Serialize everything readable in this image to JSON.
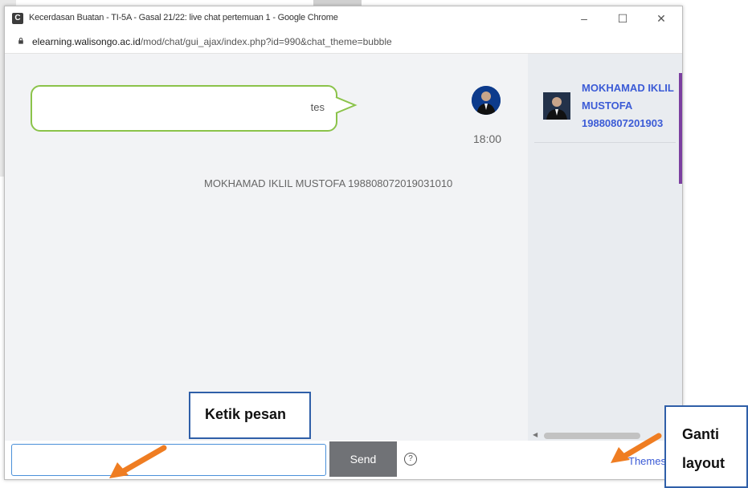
{
  "window": {
    "title": "Kecerdasan Buatan - TI-5A - Gasal 21/22: live chat pertemuan 1 - Google Chrome",
    "app_icon": "C",
    "minimize": "–",
    "maximize": "☐",
    "close": "✕"
  },
  "address": {
    "host": "elearning.walisongo.ac.id",
    "path": "/mod/chat/gui_ajax/index.php?id=990&chat_theme=bubble"
  },
  "chat": {
    "messages": [
      {
        "text": "tes",
        "time": "18:00",
        "sender": "MOKHAMAD IKLIL MUSTOFA 198808072019031010"
      }
    ]
  },
  "users": [
    {
      "name_line1": "MOKHAMAD IKLIL",
      "name_line2": "MUSTOFA",
      "name_line3": "19880807201903"
    }
  ],
  "composer": {
    "placeholder": "",
    "value": "",
    "send_label": "Send",
    "help_symbol": "?",
    "themes_label": "Themes"
  },
  "annotations": {
    "input_label": "Ketik pesan",
    "layout_label_1": "Ganti",
    "layout_label_2": "layout"
  },
  "colors": {
    "bubble_border": "#8bc34a",
    "link": "#3b5bd6",
    "send_button": "#707276",
    "arrow": "#ef7d22",
    "callout_border": "#2f5fa8"
  },
  "icons": {
    "lock": "lock-icon",
    "help": "help-icon",
    "arrows": "arrow-icon"
  }
}
